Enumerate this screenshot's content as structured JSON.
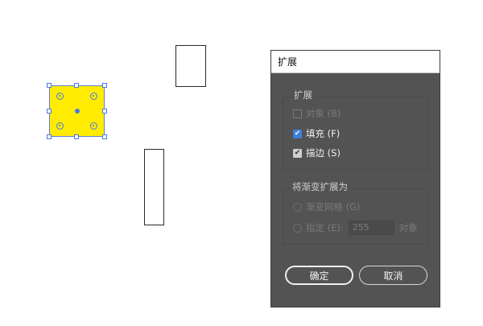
{
  "canvas": {
    "selected_fill_color": "#ffec00",
    "selection_color": "#4b79e6"
  },
  "dialog": {
    "title": "扩展",
    "expand_group": {
      "title": "扩展",
      "object_label": "对象 (B)",
      "object_checked": false,
      "fill_label": "填充 (F)",
      "fill_checked": true,
      "stroke_label": "描边 (S)",
      "stroke_checked": true
    },
    "gradient_group": {
      "title": "将渐变扩展为",
      "mesh_label": "渐变网格 (G)",
      "specify_label": "指定 (E):",
      "specify_value": "255",
      "specify_unit": "对象"
    },
    "ok_label": "确定",
    "cancel_label": "取消"
  }
}
